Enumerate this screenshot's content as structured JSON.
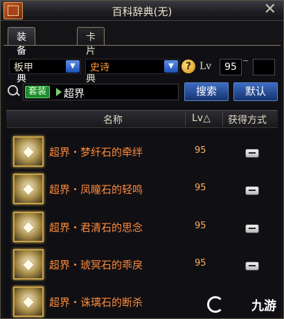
{
  "window": {
    "title": "百科辞典(无)",
    "close_label": "✕"
  },
  "tabs": [
    {
      "label": "装备辞典",
      "active": true
    },
    {
      "label": "卡片辞典",
      "active": false
    }
  ],
  "filters": {
    "type_value": "板甲",
    "rarity_value": "史诗",
    "help_label": "?",
    "lv_label": "Lv",
    "lv_min": "95",
    "lv_tilde": "~",
    "lv_max": ""
  },
  "search": {
    "tag_label": "套装",
    "query": "超界",
    "search_button": "搜索",
    "default_button": "默认"
  },
  "table": {
    "headers": {
      "name": "名称",
      "lv": "Lv△",
      "source": "获得方式"
    },
    "rows": [
      {
        "name": "超界・梦纤石的牵绊",
        "lv": "95"
      },
      {
        "name": "超界・凤瞳石的轻鸣",
        "lv": "95"
      },
      {
        "name": "超界・君清石的思念",
        "lv": "95"
      },
      {
        "name": "超界・琥冥石的乖戾",
        "lv": "95"
      },
      {
        "name": "超界・诛璃石的断杀",
        "lv": ""
      }
    ]
  },
  "watermark": {
    "text": "九游"
  },
  "colors": {
    "item_name": "#ff8a3a",
    "button": "#2a56a8",
    "tag": "#1f8a2e"
  }
}
